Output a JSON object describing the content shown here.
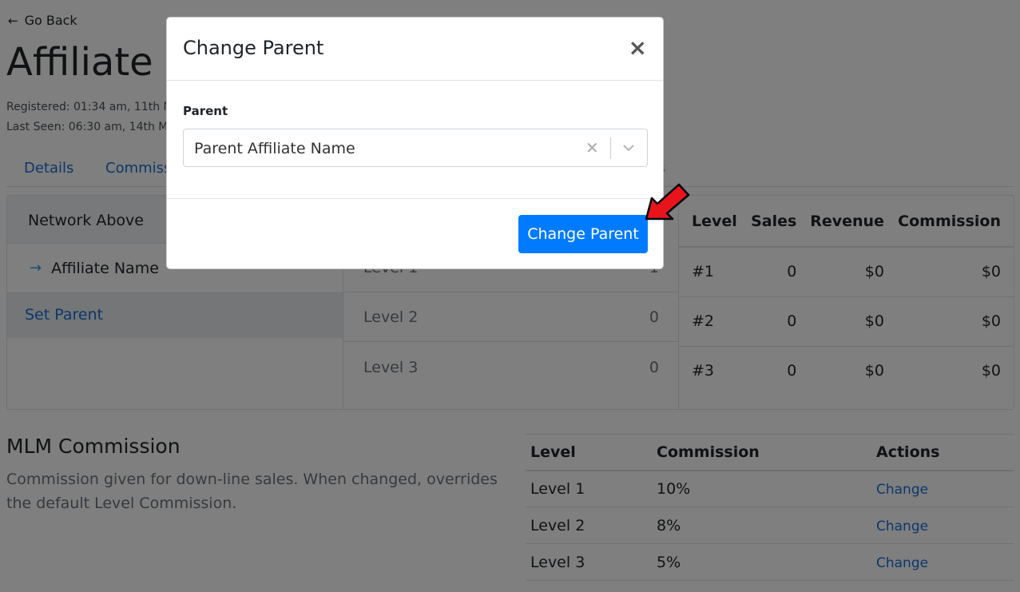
{
  "header": {
    "go_back": "Go Back",
    "title": "Affiliate N",
    "registered": "Registered: 01:34 am, 11th M",
    "last_seen": "Last Seen: 06:30 am, 14th Ma"
  },
  "tabs": [
    {
      "label": "Details"
    },
    {
      "label": "Commiss"
    },
    {
      "label": "gs"
    }
  ],
  "network_above": {
    "header": "Network Above",
    "item": "Affiliate Name",
    "set_parent": "Set Parent"
  },
  "levels": [
    {
      "label": "Level 1",
      "count": "1"
    },
    {
      "label": "Level 2",
      "count": "0"
    },
    {
      "label": "Level 3",
      "count": "0"
    }
  ],
  "stats": {
    "headers": [
      "Level",
      "Sales",
      "Revenue",
      "Commission"
    ],
    "rows": [
      [
        "#1",
        "0",
        "$0",
        "$0"
      ],
      [
        "#2",
        "0",
        "$0",
        "$0"
      ],
      [
        "#3",
        "0",
        "$0",
        "$0"
      ]
    ]
  },
  "mlm": {
    "title": "MLM Commission",
    "description": "Commission given for down-line sales. When changed, overrides the default Level Commission.",
    "headers": [
      "Level",
      "Commission",
      "Actions"
    ],
    "rows": [
      {
        "level": "Level 1",
        "commission": "10%",
        "action": "Change"
      },
      {
        "level": "Level 2",
        "commission": "8%",
        "action": "Change"
      },
      {
        "level": "Level 3",
        "commission": "5%",
        "action": "Change"
      }
    ]
  },
  "modal": {
    "title": "Change Parent",
    "close": "×",
    "field_label": "Parent",
    "select_value": "Parent Affiliate Name",
    "submit_label": "Change Parent"
  },
  "colors": {
    "primary": "#007bff",
    "link": "#1a6fd6",
    "overlay": "rgba(0,0,0,0.5)",
    "pointer_arrow": "#e8141b"
  },
  "icons": {
    "go_back": "arrow-left-icon",
    "network_item": "arrow-right-icon",
    "modal_close": "close-icon",
    "select_clear": "clear-icon",
    "select_open": "chevron-down-icon",
    "annotation": "pointer-arrow-icon"
  }
}
